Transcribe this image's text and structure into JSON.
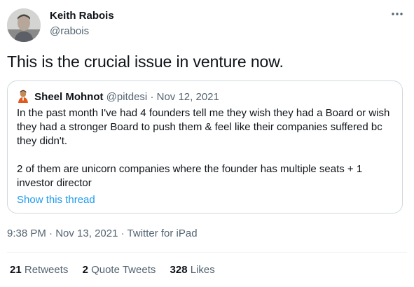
{
  "tweet": {
    "author": {
      "name": "Keith Rabois",
      "handle": "@rabois"
    },
    "more_icon": "more-horizontal-icon",
    "text": "This is the crucial issue in venture now.",
    "quote": {
      "author_name": "Sheel Mohnot",
      "author_handle": "@pitdesi",
      "separator": "·",
      "date": "Nov 12, 2021",
      "paragraphs": [
        "In the past month I've had 4 founders tell me they wish they had a Board or wish they had a stronger Board to push them & feel like their companies suffered bc they didn't.",
        "2 of them are unicorn companies where the founder has multiple seats + 1 investor director"
      ],
      "show_thread": "Show this thread"
    },
    "meta": {
      "time": "9:38 PM",
      "sep1": "·",
      "date": "Nov 13, 2021",
      "sep2": "·",
      "source": "Twitter for iPad"
    },
    "stats": {
      "retweets_count": "21",
      "retweets_label": "Retweets",
      "quotes_count": "2",
      "quotes_label": "Quote Tweets",
      "likes_count": "328",
      "likes_label": "Likes"
    }
  },
  "colors": {
    "text_primary": "#0f1419",
    "text_secondary": "#536471",
    "link": "#1d9bf0",
    "border": "#cfd9de"
  }
}
